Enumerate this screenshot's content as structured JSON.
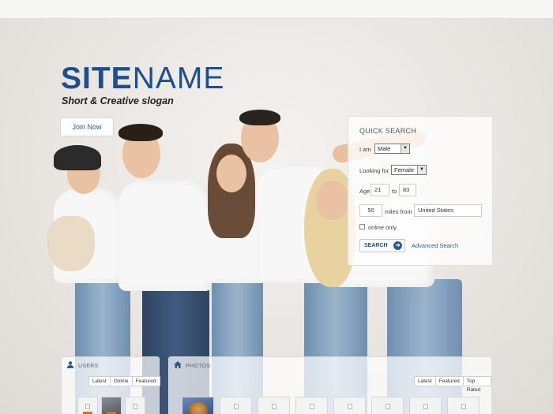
{
  "brand": {
    "name_part1": "SITE",
    "name_part2": "NAME",
    "slogan": "Short & Creative slogan",
    "color": "#1f4f8a"
  },
  "hero": {
    "join_label": "Join Now"
  },
  "quick_search": {
    "title": "QUICK SEARCH",
    "i_am_label": "I am",
    "i_am_value": "Male",
    "looking_for_label": "Looking for",
    "looking_for_value": "Female",
    "age_label": "Age",
    "age_from": "21",
    "age_to_label": "to",
    "age_to": "83",
    "miles_value": "50",
    "miles_from_label": "miles from",
    "location_value": "United States",
    "online_only_label": "online only",
    "search_label": "SEARCH",
    "advanced_label": "Advanced Search"
  },
  "users_panel": {
    "title": "USERS",
    "icon": "user-icon",
    "tabs": [
      "Latest",
      "Online",
      "Featured"
    ]
  },
  "photos_panel": {
    "title": "PHOTOS",
    "icon": "home-icon",
    "tabs": [
      "Latest",
      "Featured",
      "Top Rated"
    ]
  }
}
